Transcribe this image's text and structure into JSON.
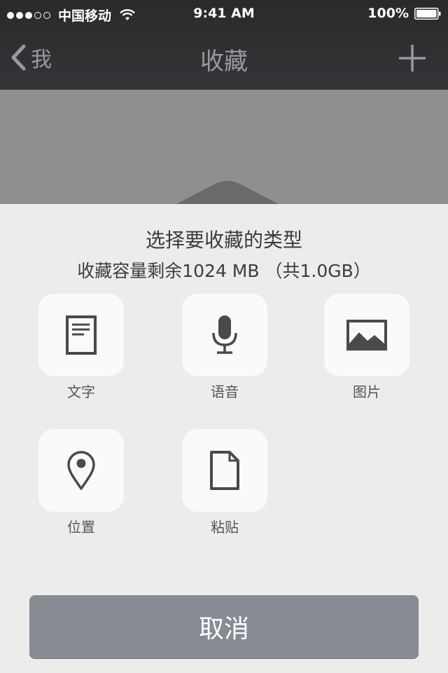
{
  "status_bar": {
    "carrier": "中国移动",
    "time": "9:41 AM",
    "battery": "100%",
    "signal_bars_filled": 3,
    "signal_bars_total": 5
  },
  "nav": {
    "back_label": "我",
    "title": "收藏",
    "add_icon": "plus-icon"
  },
  "sheet": {
    "title": "选择要收藏的类型",
    "subtitle": "收藏容量剩余1024 MB （共1.0GB）",
    "options": [
      {
        "label": "文字",
        "icon": "document-icon"
      },
      {
        "label": "语音",
        "icon": "microphone-icon"
      },
      {
        "label": "图片",
        "icon": "image-icon"
      },
      {
        "label": "位置",
        "icon": "location-pin-icon"
      },
      {
        "label": "粘贴",
        "icon": "blank-page-icon"
      }
    ],
    "cancel_label": "取消"
  },
  "colors": {
    "nav_background": "#2a2a2c",
    "sheet_background": "#ececec",
    "cancel_button": "#888b92",
    "icon": "#4a4a4a"
  }
}
